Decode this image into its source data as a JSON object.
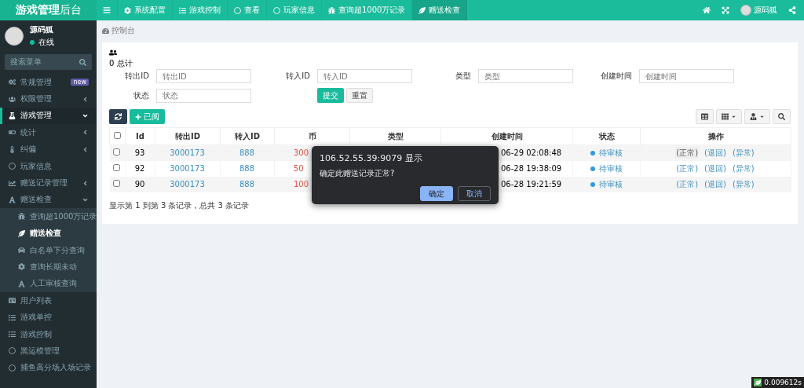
{
  "brand": {
    "bold": "游戏管理",
    "light": "后台"
  },
  "topnav": {
    "tabs": [
      {
        "label": "系统配置",
        "selected": false
      },
      {
        "label": "游戏控制",
        "selected": false
      },
      {
        "label": "查看",
        "selected": false
      },
      {
        "label": "玩家信息",
        "selected": false
      },
      {
        "label": "查询超1000万记录",
        "selected": false
      },
      {
        "label": "赠送检查",
        "selected": true
      }
    ],
    "user": "源码狐"
  },
  "sidebar": {
    "user": {
      "name": "源码狐",
      "status": "在线"
    },
    "search": {
      "placeholder": "搜索菜单"
    },
    "items": [
      {
        "label": "常规管理",
        "badge": "new",
        "selected": false
      },
      {
        "label": "权限管理",
        "expandable": true,
        "expanded": false,
        "selected": false
      },
      {
        "label": "游戏管理",
        "expandable": true,
        "expanded": true,
        "selected": true
      },
      {
        "label": "统计",
        "expandable": true,
        "expanded": false,
        "selected": false
      },
      {
        "label": "纠偏",
        "expandable": true,
        "expanded": false,
        "selected": false
      },
      {
        "label": "玩家信息",
        "selected": false
      },
      {
        "label": "赠送记录管理",
        "expandable": true,
        "expanded": false,
        "selected": false
      },
      {
        "label": "赠送检查",
        "expandable": true,
        "expanded": true,
        "selected": false,
        "children": [
          {
            "label": "查询超1000万记录",
            "selected": false
          },
          {
            "label": "赠送检查",
            "selected": true
          },
          {
            "label": "白名单下分查询",
            "selected": false
          },
          {
            "label": "查询长期未动",
            "selected": false
          },
          {
            "label": "人工审核查询",
            "selected": false
          }
        ]
      },
      {
        "label": "用户列表",
        "selected": false
      },
      {
        "label": "游戏单控",
        "selected": false
      },
      {
        "label": "游戏控制",
        "selected": false
      },
      {
        "label": "黑运模管理",
        "selected": false
      },
      {
        "label": "捕鱼高分场入场记录",
        "selected": false
      }
    ]
  },
  "breadcrumb": "控制台",
  "panel": {
    "total": "0 总计",
    "filters": [
      {
        "label": "转出ID",
        "placeholder": "转出ID"
      },
      {
        "label": "转入ID",
        "placeholder": "转入ID"
      },
      {
        "label": "类型",
        "placeholder": "类型"
      },
      {
        "label": "创建时间",
        "placeholder": "创建时间"
      },
      {
        "label": "状态",
        "placeholder": "状态"
      }
    ],
    "submit": "提交",
    "reset": "重置",
    "read_button": "已阅",
    "table": {
      "all_checked": false,
      "columns": [
        "Id",
        "转出ID",
        "转入ID",
        "币",
        "类型",
        "创建时间",
        "状态",
        "操作"
      ],
      "rows": [
        {
          "checked": false,
          "id": "93",
          "out": "3000173",
          "in": "888",
          "coin": "300",
          "time": "06-29 02:08:48",
          "status": {
            "text": "待审核",
            "color": "#3498db"
          },
          "actions": [
            {
              "label": "(正常)",
              "selected": true
            },
            {
              "label": "(退回)",
              "selected": false
            },
            {
              "label": "(异常)",
              "selected": false
            }
          ]
        },
        {
          "checked": false,
          "id": "92",
          "out": "3000173",
          "in": "888",
          "coin": "50",
          "time": "06-28 19:38:09",
          "status": {
            "text": "待审核",
            "color": "#3498db"
          },
          "actions": [
            {
              "label": "(正常)",
              "selected": false
            },
            {
              "label": "(退回)",
              "selected": false
            },
            {
              "label": "(异常)",
              "selected": false
            }
          ]
        },
        {
          "checked": false,
          "id": "90",
          "out": "3000173",
          "in": "888",
          "coin": "100",
          "time": "06-28 19:21:59",
          "status": {
            "text": "待审核",
            "color": "#3498db"
          },
          "actions": [
            {
              "label": "(正常)",
              "selected": false
            },
            {
              "label": "(退回)",
              "selected": false
            },
            {
              "label": "(异常)",
              "selected": false
            }
          ]
        }
      ]
    },
    "footer": "显示第 1 到第 3 条记录，总共 3 条记录"
  },
  "dialog": {
    "title": "106.52.55.39:9079 显示",
    "message": "确定此赠送记录正常?",
    "buttons": [
      {
        "label": "确定",
        "primary": true
      },
      {
        "label": "取消",
        "primary": false
      }
    ]
  },
  "timer": "0.009612s"
}
